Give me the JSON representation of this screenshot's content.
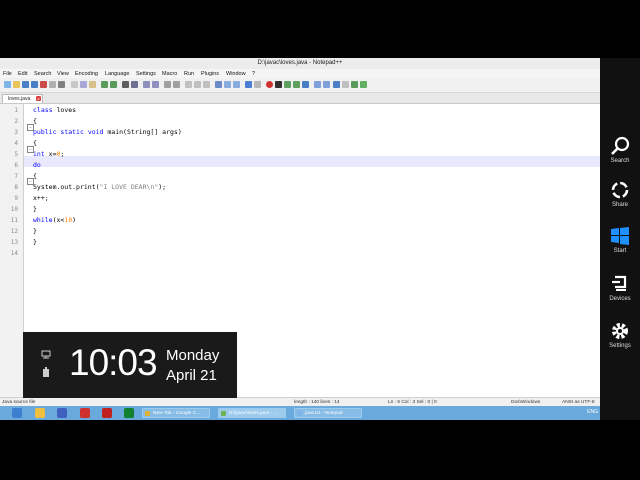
{
  "window": {
    "title": "D:\\javac\\loves.java - Notepad++"
  },
  "menu": [
    "File",
    "Edit",
    "Search",
    "View",
    "Encoding",
    "Language",
    "Settings",
    "Macro",
    "Run",
    "Plugins",
    "Window",
    "?"
  ],
  "tab": {
    "label": "loves.java",
    "close": "x"
  },
  "code_lines": [
    {
      "n": "1",
      "text": "class loves"
    },
    {
      "n": "2",
      "text": "{"
    },
    {
      "n": "3",
      "text": "public static void main(String[] args)"
    },
    {
      "n": "4",
      "text": "{"
    },
    {
      "n": "5",
      "text": "int x=0;"
    },
    {
      "n": "6",
      "text": "do"
    },
    {
      "n": "7",
      "text": "{"
    },
    {
      "n": "8",
      "text": "System.out.print(\"I LOVE DEAR\\n\");"
    },
    {
      "n": "9",
      "text": "x++;"
    },
    {
      "n": "10",
      "text": "}"
    },
    {
      "n": "11",
      "text": "while(x<10)"
    },
    {
      "n": "12",
      "text": "}"
    },
    {
      "n": "13",
      "text": "}"
    },
    {
      "n": "14",
      "text": ""
    }
  ],
  "status": {
    "file_type": "Java source file",
    "length_lines": "length : 140    lines : 14",
    "position": "Ln : 6    Col : 3    Sel : 0 | 0",
    "eol": "Dos\\Windows",
    "encoding": "ANSI as UTF-8",
    "ins": "INS"
  },
  "taskbar": {
    "tasks": [
      "New Tab - Google C...",
      "D:\\javac\\loves.java - ...",
      "java.txt - Notepad"
    ],
    "tray_lang": "ENG"
  },
  "charms": [
    "Search",
    "Share",
    "Start",
    "Devices",
    "Settings"
  ],
  "clock": {
    "time": "10:03",
    "day": "Monday",
    "date": "April 21"
  },
  "colors": {
    "keyword": "#0000ff",
    "number": "#ff8000",
    "string": "#808080",
    "taskbar": "#6aa9dc",
    "charms_bg": "#111111"
  }
}
